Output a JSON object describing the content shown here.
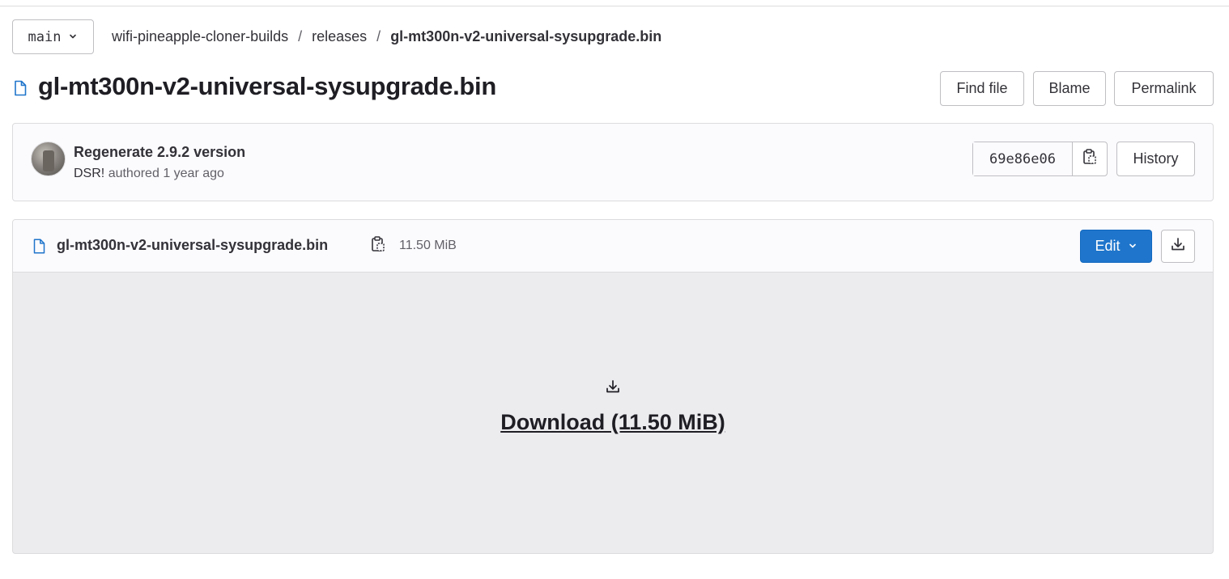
{
  "branch": {
    "name": "main",
    "icon": "chevron-down-icon"
  },
  "breadcrumb": {
    "items": [
      "wifi-pineapple-cloner-builds",
      "releases"
    ],
    "current": "gl-mt300n-v2-universal-sysupgrade.bin",
    "separator": "/"
  },
  "page": {
    "title": "gl-mt300n-v2-universal-sysupgrade.bin",
    "title_icon": "file-icon"
  },
  "actions": {
    "find_file": "Find file",
    "blame": "Blame",
    "permalink": "Permalink"
  },
  "commit": {
    "message": "Regenerate 2.9.2 version",
    "author": "DSR!",
    "authored_text": "authored",
    "time": "1 year ago",
    "sha": "69e86e06",
    "copy_icon": "clipboard-icon",
    "history": "History"
  },
  "file": {
    "name": "gl-mt300n-v2-universal-sysupgrade.bin",
    "size": "11.50 MiB",
    "icon": "file-icon",
    "copy_icon": "clipboard-icon",
    "edit_label": "Edit",
    "download_icon": "download-icon",
    "download_link": "Download (11.50 MiB)"
  },
  "colors": {
    "primary": "#1f75cb",
    "border": "#dcdcde",
    "panel_bg": "#fbfafd",
    "viewer_bg": "#ececef",
    "file_icon": "#1f75cb"
  }
}
